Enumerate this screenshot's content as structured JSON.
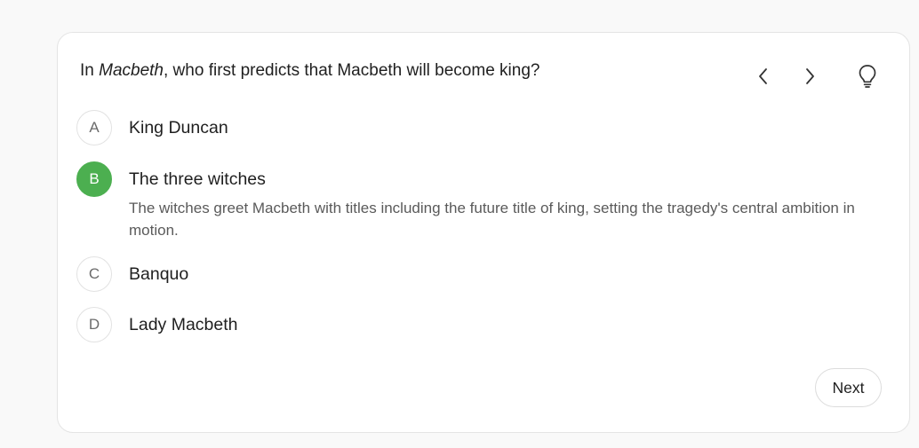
{
  "question": {
    "prefix": "In ",
    "italic": "Macbeth",
    "suffix": ", who first predicts that Macbeth will become king?"
  },
  "toolbar": {
    "prev_icon": "chevron-left-icon",
    "next_icon": "chevron-right-icon",
    "hint_icon": "lightbulb-icon"
  },
  "options": [
    {
      "letter": "A",
      "label": "King Duncan",
      "selected": false
    },
    {
      "letter": "B",
      "label": "The three witches",
      "selected": true,
      "explanation": "The witches greet Macbeth with titles including the future title of king, setting the tragedy's central ambition in motion."
    },
    {
      "letter": "C",
      "label": "Banquo",
      "selected": false
    },
    {
      "letter": "D",
      "label": "Lady Macbeth",
      "selected": false
    }
  ],
  "footer": {
    "next_label": "Next"
  },
  "colors": {
    "selected": "#4caf50",
    "border": "#e2e2e2"
  }
}
